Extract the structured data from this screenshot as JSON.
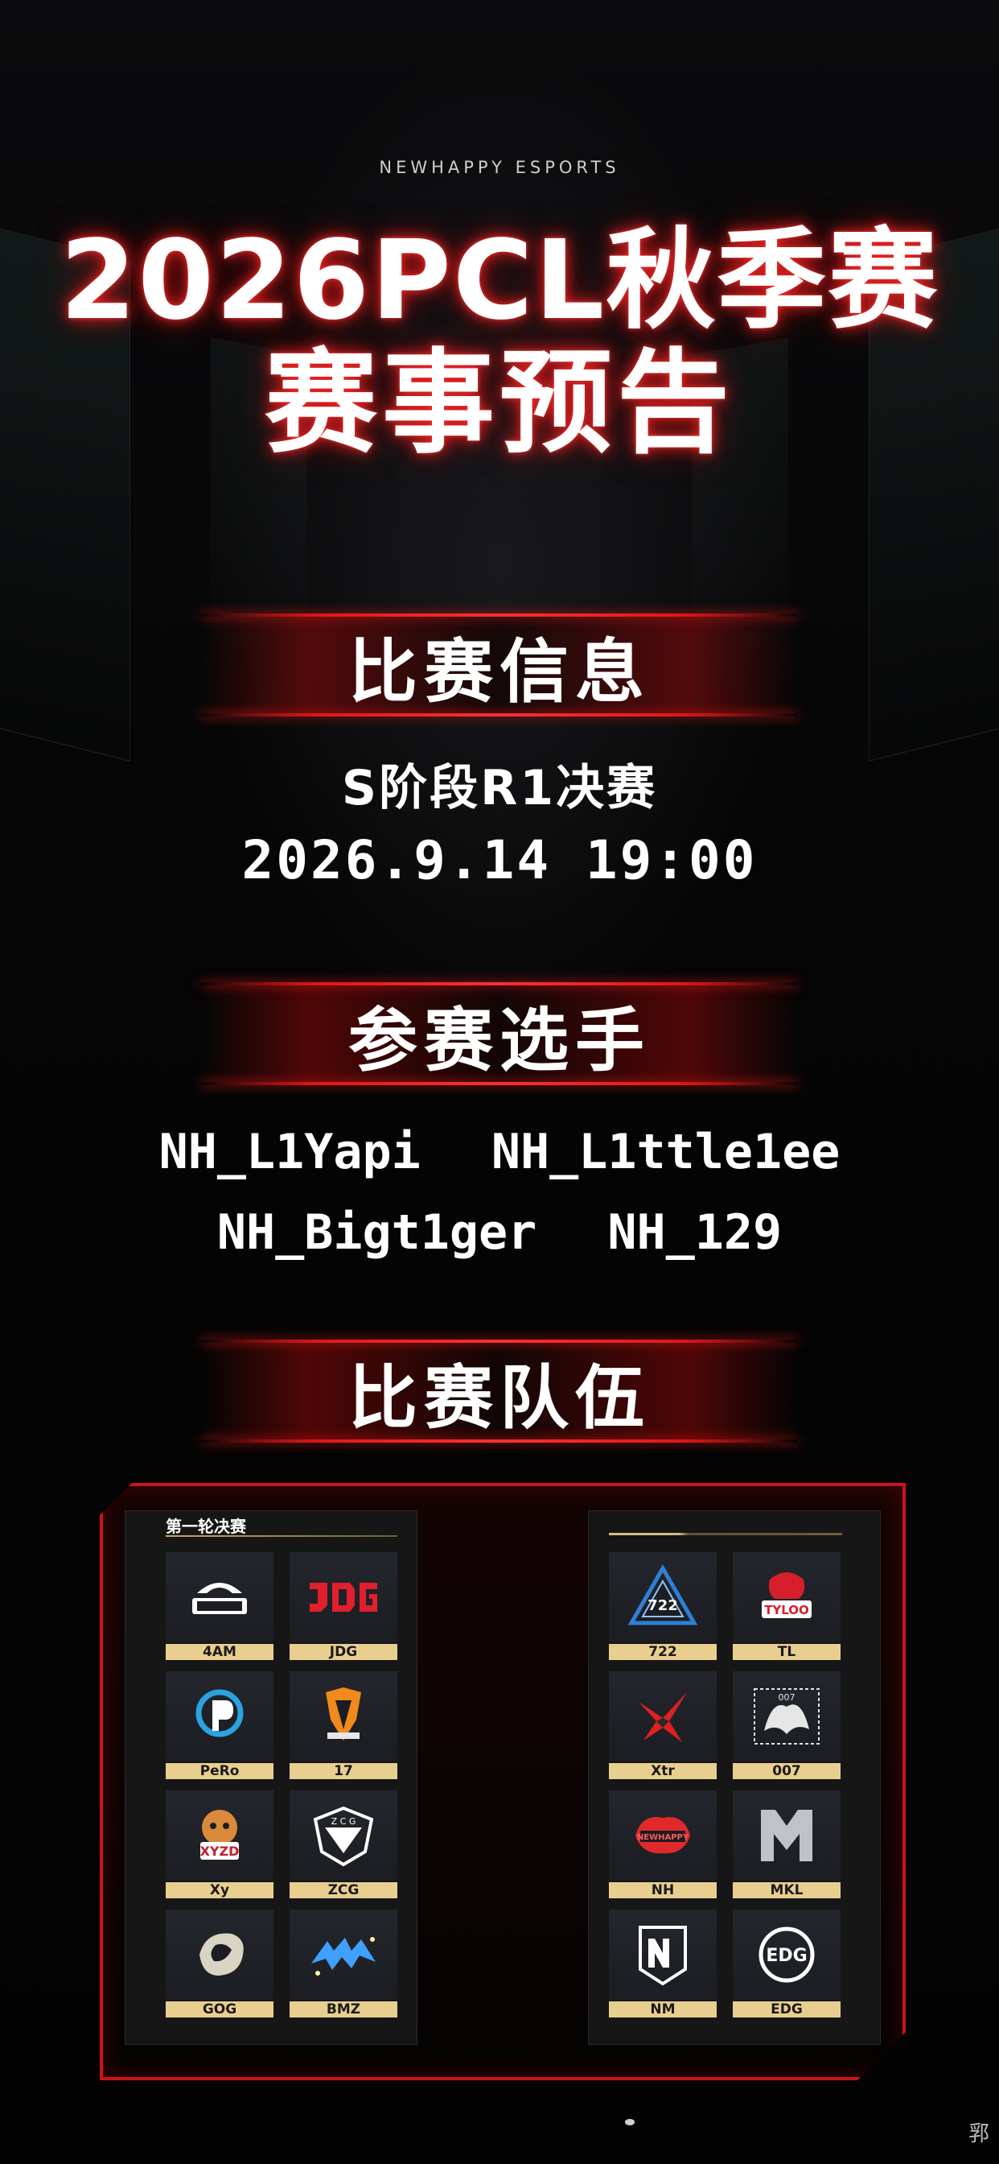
{
  "header": {
    "brand": "NEWHAPPY ESPORTS",
    "title_line1": "2026PCL秋季赛",
    "title_line2": "赛事预告"
  },
  "sections": {
    "info": "比赛信息",
    "players": "参赛选手",
    "teams": "比赛队伍"
  },
  "match": {
    "stage": "S阶段R1决赛",
    "datetime": "2026.9.14 19:00"
  },
  "players": [
    "NH_L1Yapi",
    "NH_L1ttle1ee",
    "NH_Bigt1ger",
    "NH_129"
  ],
  "teams_board": {
    "left_title": "第一轮决赛",
    "left": [
      {
        "name": "4AM",
        "logo": "4am-logo",
        "color": "#ffffff"
      },
      {
        "name": "JDG",
        "logo": "jdg-logo",
        "color": "#e0202e"
      },
      {
        "name": "PeRo",
        "logo": "pero-logo",
        "color": "#2aa3e0"
      },
      {
        "name": "17",
        "logo": "17-gaming-logo",
        "color": "#f08a1c"
      },
      {
        "name": "Xy",
        "logo": "xyzd-logo",
        "color": "#c0202a"
      },
      {
        "name": "ZCG",
        "logo": "zcg-logo",
        "color": "#ffffff"
      },
      {
        "name": "GOG",
        "logo": "gog-logo",
        "color": "#d9d4c4"
      },
      {
        "name": "BMZ",
        "logo": "bmz-logo",
        "color": "#3fa0ff"
      }
    ],
    "right": [
      {
        "name": "722",
        "logo": "722-logo",
        "color": "#2f7fd6"
      },
      {
        "name": "TL",
        "logo": "tyloo-logo",
        "color": "#d61f2a"
      },
      {
        "name": "Xtr",
        "logo": "xtr-logo",
        "color": "#e02020"
      },
      {
        "name": "007",
        "logo": "007-logo",
        "color": "#e6e6e6"
      },
      {
        "name": "NH",
        "logo": "nh-logo",
        "color": "#e02a2a"
      },
      {
        "name": "MKL",
        "logo": "mkl-logo",
        "color": "#bfc3c9"
      },
      {
        "name": "NM",
        "logo": "nm-logo",
        "color": "#ffffff"
      },
      {
        "name": "EDG",
        "logo": "edg-logo",
        "color": "#ffffff"
      }
    ]
  },
  "footer": {
    "corner_mark": "郛"
  }
}
